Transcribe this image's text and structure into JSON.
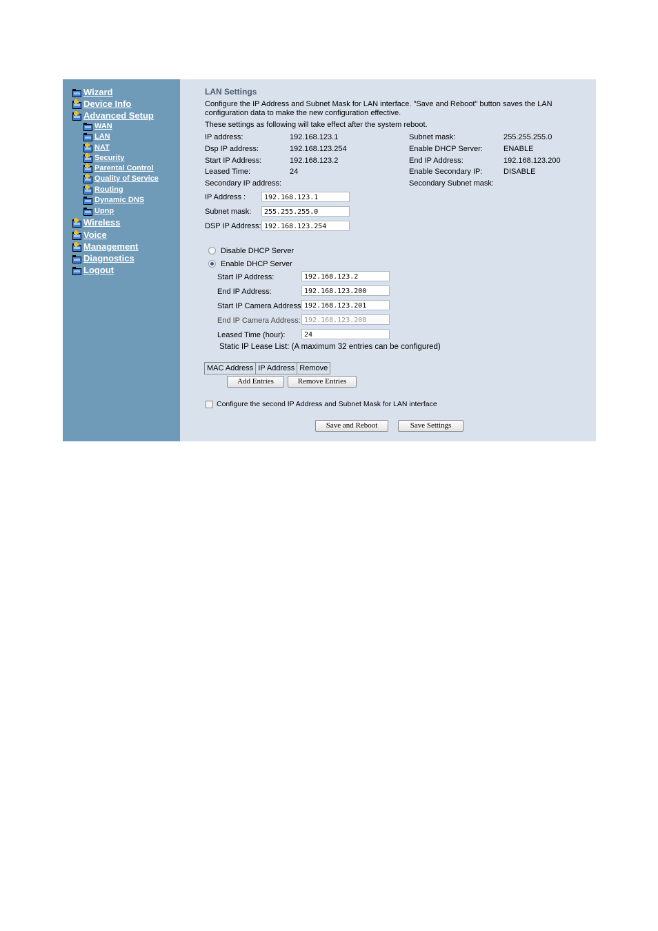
{
  "sidebar": {
    "items": [
      {
        "label": "Wizard",
        "icon": "folder-icon"
      },
      {
        "label": "Device Info",
        "icon": "folder-plus-icon"
      },
      {
        "label": "Advanced Setup",
        "icon": "folder-plus-icon"
      },
      {
        "label": "WAN",
        "icon": "folder-icon"
      },
      {
        "label": "LAN",
        "icon": "folder-icon"
      },
      {
        "label": "NAT",
        "icon": "folder-plus-icon"
      },
      {
        "label": "Security",
        "icon": "folder-plus-icon"
      },
      {
        "label": "Parental Control",
        "icon": "folder-plus-icon"
      },
      {
        "label": "Quality of Service",
        "icon": "folder-plus-icon"
      },
      {
        "label": "Routing",
        "icon": "folder-plus-icon"
      },
      {
        "label": "Dynamic DNS",
        "icon": "folder-icon"
      },
      {
        "label": "Upnp",
        "icon": "folder-icon"
      },
      {
        "label": "Wireless",
        "icon": "folder-plus-icon"
      },
      {
        "label": "Voice",
        "icon": "folder-plus-icon"
      },
      {
        "label": "Management",
        "icon": "folder-plus-icon"
      },
      {
        "label": "Diagnostics",
        "icon": "folder-icon"
      },
      {
        "label": "Logout",
        "icon": "folder-icon"
      }
    ]
  },
  "main": {
    "title": "LAN Settings",
    "description_line1": "Configure the IP Address and Subnet Mask for LAN interface. \"Save and Reboot\" button saves the LAN",
    "description_line2": "configuration data to make the new configuration effective.",
    "reboot_note": "These settings as following will take effect after the system reboot.",
    "summary": {
      "left": [
        {
          "label": "IP address:",
          "value": "192.168.123.1"
        },
        {
          "label": "Dsp IP address:",
          "value": "192.168.123.254"
        },
        {
          "label": "Start IP Address:",
          "value": "192.168.123.2"
        },
        {
          "label": "Leased Time:",
          "value": "24"
        },
        {
          "label": "Secondary IP address:",
          "value": ""
        }
      ],
      "right": [
        {
          "label": "Subnet mask:",
          "value": "255.255.255.0"
        },
        {
          "label": "Enable DHCP Server:",
          "value": "ENABLE"
        },
        {
          "label": "End IP Address:",
          "value": "192.168.123.200"
        },
        {
          "label": "Enable Secondary IP:",
          "value": "DISABLE"
        },
        {
          "label": "Secondary Subnet mask:",
          "value": ""
        }
      ]
    },
    "lan_fields": [
      {
        "label": "IP Address :",
        "value": "192.168.123.1"
      },
      {
        "label": "Subnet mask:",
        "value": "255.255.255.0"
      },
      {
        "label": "DSP IP Address:",
        "value": "192.168.123.254"
      }
    ],
    "dhcp": {
      "disable_label": "Disable DHCP Server",
      "enable_label": "Enable DHCP Server",
      "selected": "enable",
      "fields": [
        {
          "label": "Start IP Address:",
          "value": "192.168.123.2",
          "disabled": false
        },
        {
          "label": "End IP Address:",
          "value": "192.168.123.200",
          "disabled": false
        },
        {
          "label": "Start IP Camera Address:",
          "value": "192.168.123.201",
          "disabled": false
        },
        {
          "label": "End IP Camera Address:",
          "value": "192.168.123.208",
          "disabled": true
        },
        {
          "label": "Leased Time (hour):",
          "value": "24",
          "disabled": false
        }
      ],
      "static_lease_note": "Static IP Lease List: (A maximum 32 entries can be configured)"
    },
    "lease_table": {
      "columns": [
        "MAC Address",
        "IP Address",
        "Remove"
      ]
    },
    "buttons": {
      "add_entries": "Add Entries",
      "remove_entries": "Remove Entries",
      "save_reboot": "Save and Reboot",
      "save_settings": "Save Settings"
    },
    "second_ip_checkbox": {
      "label": "Configure the second IP Address and Subnet Mask for LAN interface",
      "checked": false
    }
  }
}
